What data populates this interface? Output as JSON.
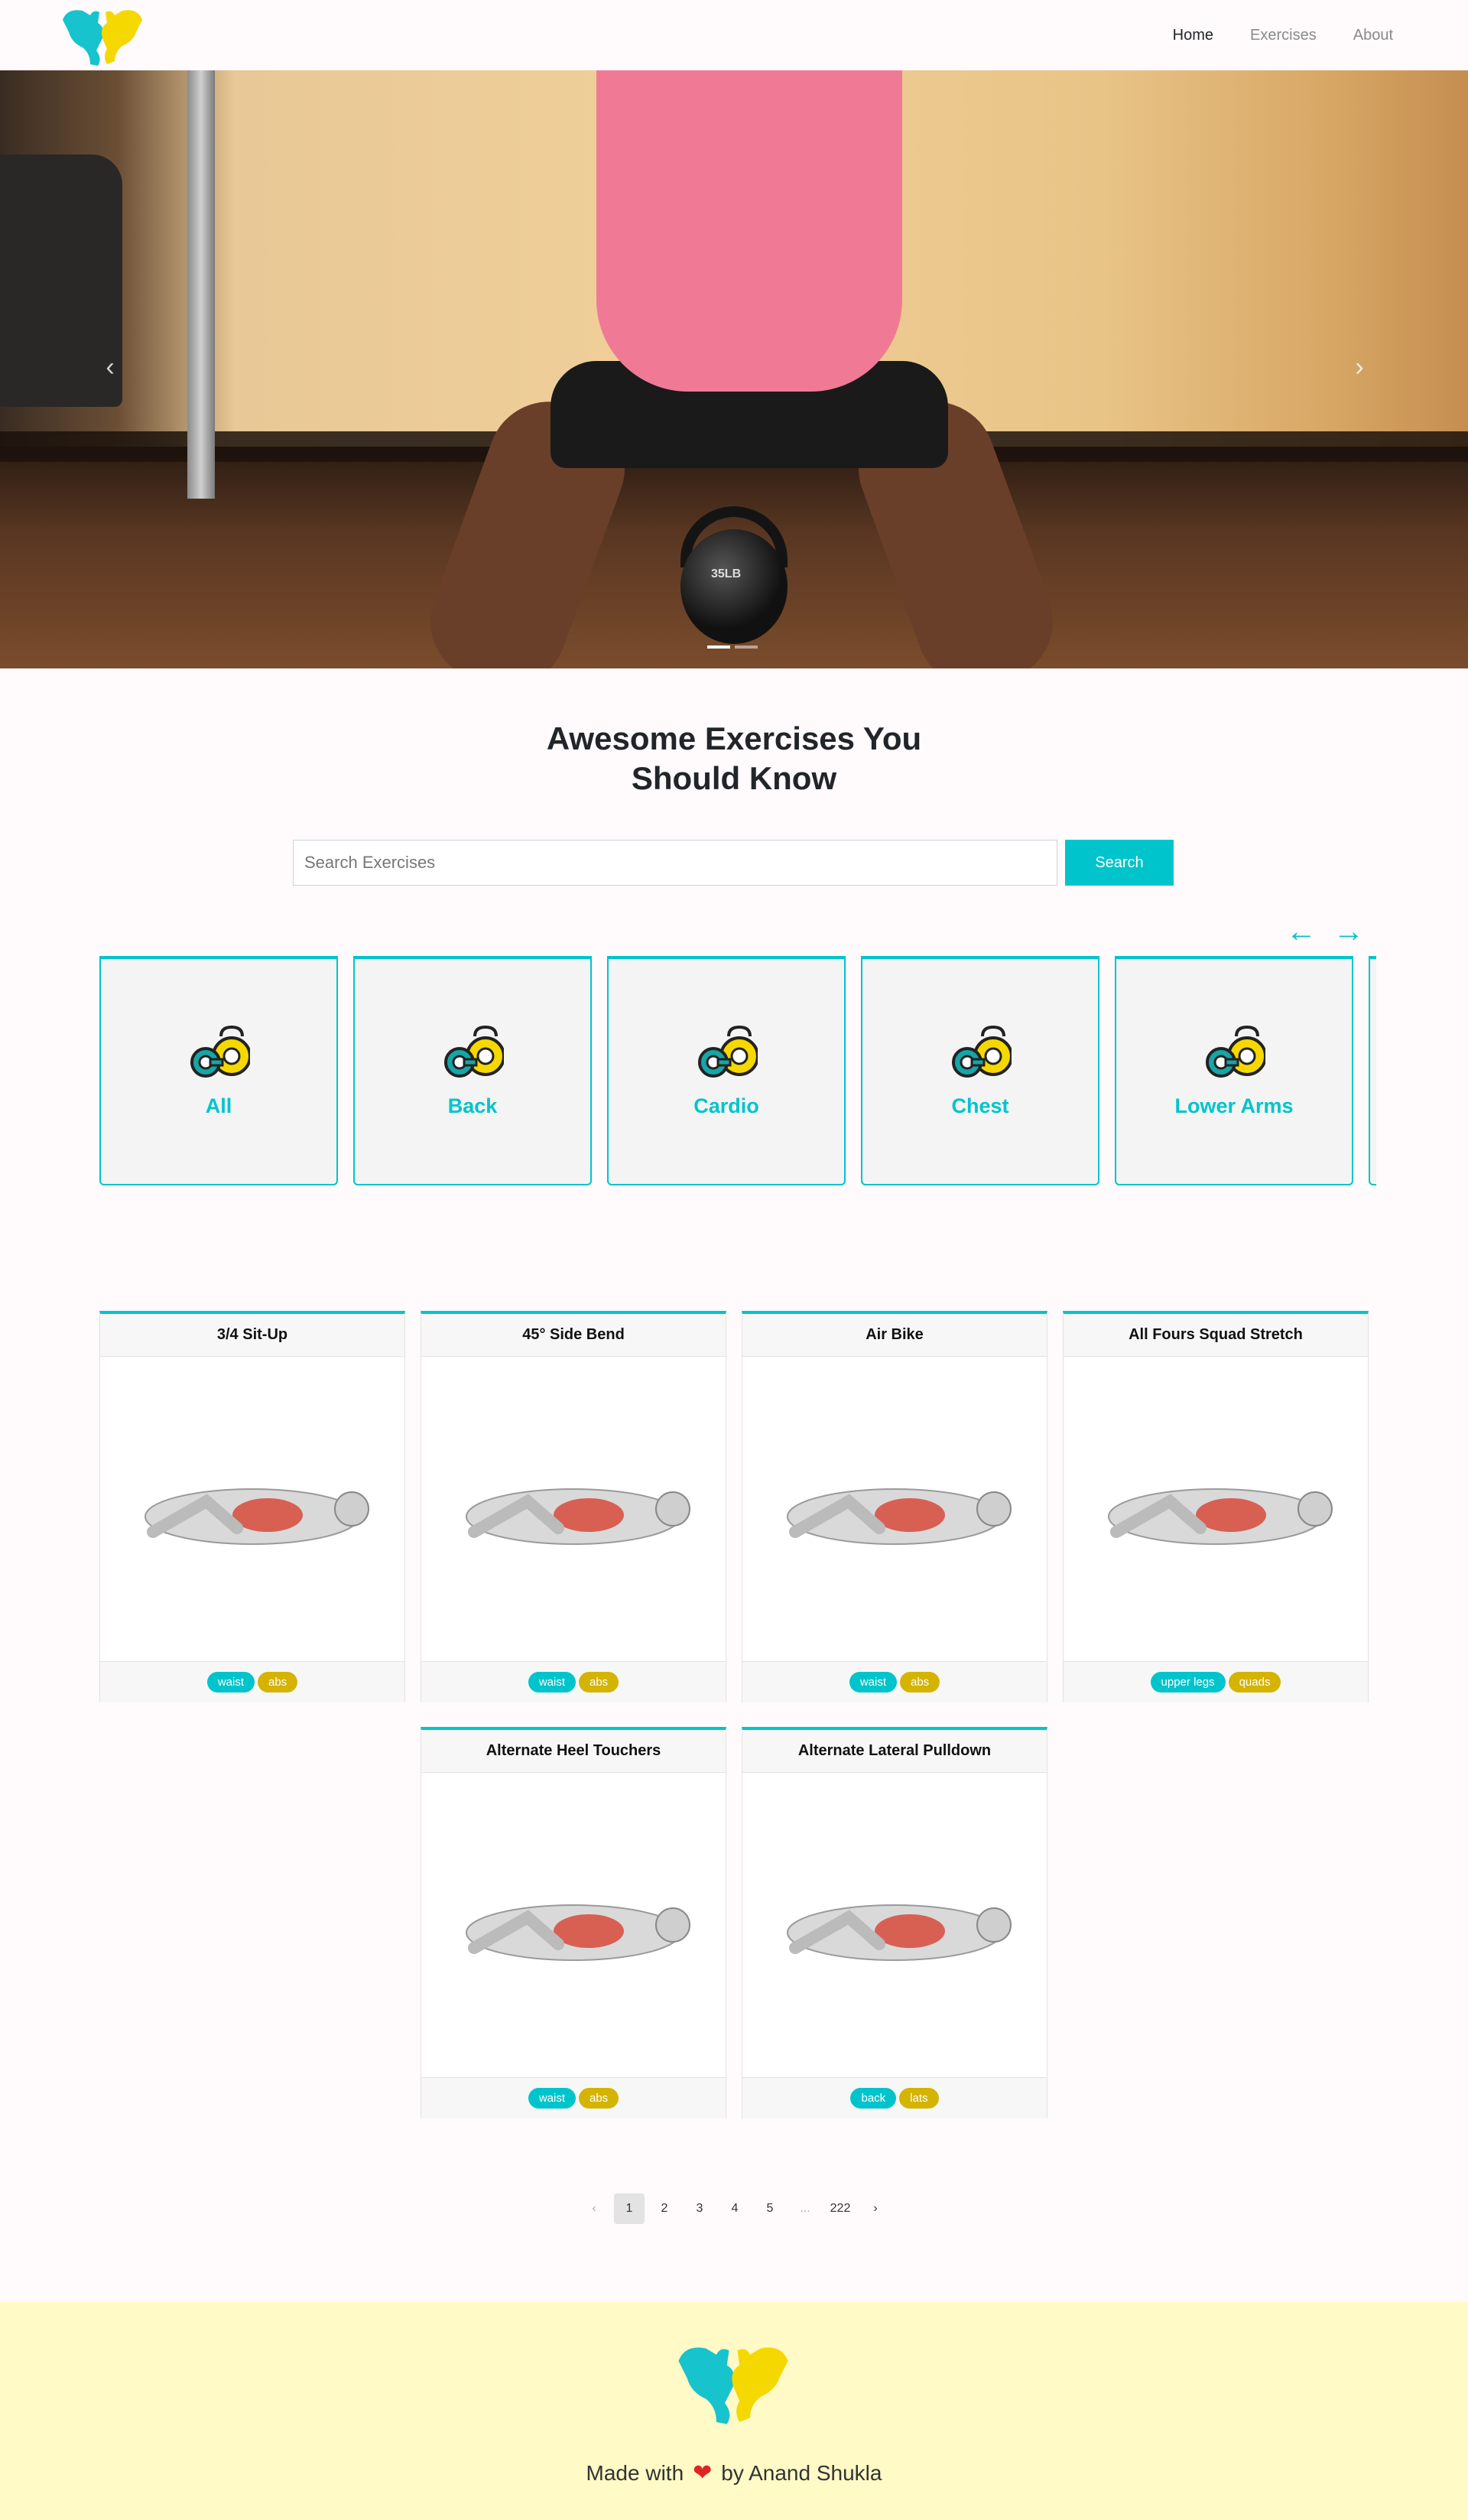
{
  "nav": {
    "links": [
      {
        "label": "Home",
        "active": true
      },
      {
        "label": "Exercises",
        "active": false
      },
      {
        "label": "About",
        "active": false
      }
    ]
  },
  "hero": {
    "kettlebell_text": "35LB",
    "slide_count": 2,
    "active_slide": 1
  },
  "heading": {
    "line1": "Awesome Exercises You",
    "line2": "Should Know"
  },
  "search": {
    "placeholder": "Search Exercises",
    "value": "",
    "button_label": "Search"
  },
  "categories": [
    {
      "label": "All",
      "icon": "dumbbell-kettlebell-icon"
    },
    {
      "label": "Back",
      "icon": "dumbbell-kettlebell-icon"
    },
    {
      "label": "Cardio",
      "icon": "dumbbell-kettlebell-icon"
    },
    {
      "label": "Chest",
      "icon": "dumbbell-kettlebell-icon"
    },
    {
      "label": "Lower Arms",
      "icon": "dumbbell-kettlebell-icon"
    },
    {
      "label": "",
      "icon": "dumbbell-kettlebell-icon"
    }
  ],
  "exercises": [
    {
      "title": "3/4 Sit-Up",
      "tags": [
        "waist",
        "abs"
      ]
    },
    {
      "title": "45° Side Bend",
      "tags": [
        "waist",
        "abs"
      ]
    },
    {
      "title": "Air Bike",
      "tags": [
        "waist",
        "abs"
      ]
    },
    {
      "title": "All Fours Squad Stretch",
      "tags": [
        "upper legs",
        "quads"
      ]
    },
    {
      "title": "Alternate Heel Touchers",
      "tags": [
        "waist",
        "abs"
      ]
    },
    {
      "title": "Alternate Lateral Pulldown",
      "tags": [
        "back",
        "lats"
      ]
    }
  ],
  "pagination": {
    "pages": [
      "1",
      "2",
      "3",
      "4",
      "5",
      "...",
      "222"
    ],
    "current": "1",
    "prev": "‹",
    "next": "›"
  },
  "footer": {
    "made_with": "Made with",
    "by": "by Anand Shukla"
  },
  "colors": {
    "accent": "#00c4cc",
    "gold": "#d4b400",
    "footer_bg": "#fffac6",
    "heart": "#e02424"
  }
}
